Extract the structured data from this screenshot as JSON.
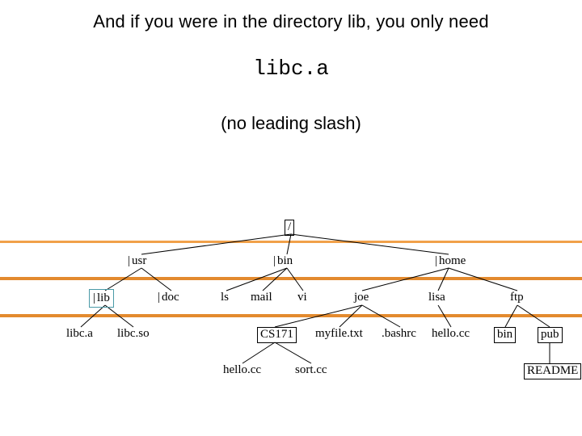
{
  "caption": {
    "line1": "And if you were in the directory lib, you only need",
    "code": "libc.a",
    "line2": "(no leading slash)"
  },
  "tree": {
    "root": "/",
    "level1": {
      "usr": "usr",
      "bin": "bin",
      "home": "home"
    },
    "level2": {
      "lib": "lib",
      "doc": "doc",
      "ls": "ls",
      "mail": "mail",
      "vi": "vi",
      "joe": "joe",
      "lisa": "lisa",
      "ftp": "ftp"
    },
    "level3": {
      "libc_a": "libc.a",
      "libc_so": "libc.so",
      "cs171": "CS171",
      "myfile": "myfile.txt",
      "bashrc": ".bashrc",
      "hello_cc": "hello.cc",
      "bin2": "bin",
      "pub": "pub"
    },
    "level4": {
      "hello2": "hello.cc",
      "sort": "sort.cc",
      "readme": "README"
    }
  },
  "chart_data": {
    "type": "diagram",
    "title": "Unix directory tree with relative path example",
    "nodes": [
      {
        "id": "root",
        "label": "/",
        "level": 0,
        "boxed": true
      },
      {
        "id": "usr",
        "label": "usr",
        "level": 1,
        "dirmark": true
      },
      {
        "id": "bin",
        "label": "bin",
        "level": 1,
        "dirmark": true
      },
      {
        "id": "home",
        "label": "home",
        "level": 1,
        "dirmark": true
      },
      {
        "id": "lib",
        "label": "lib",
        "level": 2,
        "dirmark": true,
        "highlighted": true
      },
      {
        "id": "doc",
        "label": "doc",
        "level": 2,
        "dirmark": true
      },
      {
        "id": "ls",
        "label": "ls",
        "level": 2
      },
      {
        "id": "mail",
        "label": "mail",
        "level": 2
      },
      {
        "id": "vi",
        "label": "vi",
        "level": 2
      },
      {
        "id": "joe",
        "label": "joe",
        "level": 2
      },
      {
        "id": "lisa",
        "label": "lisa",
        "level": 2
      },
      {
        "id": "ftp",
        "label": "ftp",
        "level": 2
      },
      {
        "id": "libc.a",
        "label": "libc.a",
        "level": 3
      },
      {
        "id": "libc.so",
        "label": "libc.so",
        "level": 3
      },
      {
        "id": "CS171",
        "label": "CS171",
        "level": 3,
        "boxed": true
      },
      {
        "id": "myfile.txt",
        "label": "myfile.txt",
        "level": 3
      },
      {
        "id": ".bashrc",
        "label": ".bashrc",
        "level": 3
      },
      {
        "id": "hello.cc",
        "label": "hello.cc",
        "level": 3
      },
      {
        "id": "bin2",
        "label": "bin",
        "level": 3,
        "boxed": true
      },
      {
        "id": "pub",
        "label": "pub",
        "level": 3,
        "boxed": true
      },
      {
        "id": "hello2",
        "label": "hello.cc",
        "level": 4
      },
      {
        "id": "sort.cc",
        "label": "sort.cc",
        "level": 4
      },
      {
        "id": "README",
        "label": "README",
        "level": 4,
        "boxed": true
      }
    ],
    "edges": [
      [
        "root",
        "usr"
      ],
      [
        "root",
        "bin"
      ],
      [
        "root",
        "home"
      ],
      [
        "usr",
        "lib"
      ],
      [
        "usr",
        "doc"
      ],
      [
        "bin",
        "ls"
      ],
      [
        "bin",
        "mail"
      ],
      [
        "bin",
        "vi"
      ],
      [
        "home",
        "joe"
      ],
      [
        "home",
        "lisa"
      ],
      [
        "home",
        "ftp"
      ],
      [
        "lib",
        "libc.a"
      ],
      [
        "lib",
        "libc.so"
      ],
      [
        "joe",
        "CS171"
      ],
      [
        "joe",
        "myfile.txt"
      ],
      [
        "joe",
        ".bashrc"
      ],
      [
        "lisa",
        "hello.cc"
      ],
      [
        "ftp",
        "bin2"
      ],
      [
        "ftp",
        "pub"
      ],
      [
        "CS171",
        "hello2"
      ],
      [
        "CS171",
        "sort.cc"
      ],
      [
        "pub",
        "README"
      ]
    ]
  }
}
